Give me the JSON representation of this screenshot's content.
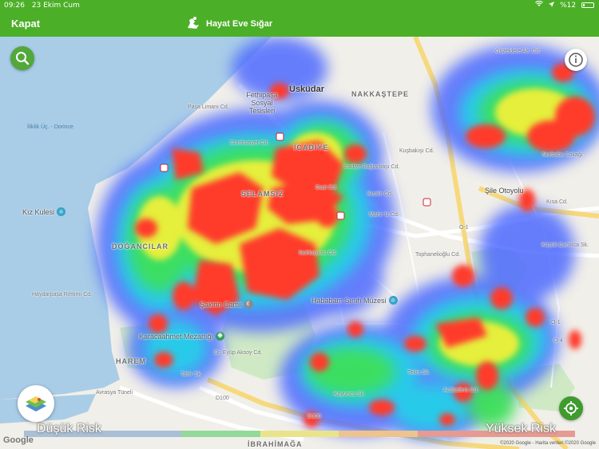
{
  "status_bar": {
    "time": "09:26",
    "date": "23 Ekim Cum",
    "battery": "%12"
  },
  "header": {
    "close_label": "Kapat",
    "title": "Hayat Eve Sığar",
    "logo_icon": "hes-logo-icon"
  },
  "map": {
    "district_labels": {
      "uskudar": "Üsküdar",
      "nakkastepe": "NAKKAŞTEPE",
      "icadiye": "İCADİYE",
      "selamsiz": "SELAMSIZ",
      "doguncular": "DOĞANCILAR",
      "harem": "HAREM",
      "ibrahimaga": "İBRAHİMAĞA"
    },
    "poi_labels": {
      "fethipasa": "Fethipaşa Sosyal Tesisleri",
      "kiz_kulesi": "Kız Kulesi",
      "sakirin": "Şakirin Camii",
      "karacaahmet": "Karacaahmet Mezarlığı",
      "hababam": "Hababam Sınıfı Müzesi"
    },
    "road_labels": {
      "sile": "Şile Otoyolu",
      "mahir": "Mahir İz Cd.",
      "avrasya": "Avrasya Tüneli",
      "kisikli": "Kısıklı Cd.",
      "kisa": "Kısa Cd.",
      "kucukbakkal": "Küçükbakkalköy",
      "kucuk_camlica": "Küçük Çamlıca Sk.",
      "nurbaba": "Nurbaba Sokağı",
      "guzeldere": "Güzeldere Alt. Cd.",
      "gazi": "Gazi Cd.",
      "kuskbaskı": "Kuşbakışı Cd.",
      "topraktaba": "Toprakçeşme Cd.",
      "tophanelioglu": "Tophanelioğlu Cd.",
      "nuhkuyusu": "Nuhkuyusu Cd.",
      "koyuncu": "Koyuncu Sk.",
      "dr_eyup": "Dr. Eyüp Aksoy Cd.",
      "tahir": "Tahir Sk.",
      "paşa_limani": "Paşa Limanı Cd.",
      "cumhuriyet": "Cumhuriyet Cd.",
      "icadiye_cd": "İcadiye Bağlarbaşı Cd.",
      "halk": "Halk Cd.",
      "d100_a": "D100",
      "d100_b": "D100",
      "o1_a": "O-1",
      "o1_b": "O-1",
      "o4": "O-4",
      "ibrahimaga_cd": "Ibrahimağa Cd.",
      "haydarpasa": "Haydarpaşa Rıhtımı Cd.",
      "acibadem": "Acıbadem Cd.",
      "tekin": "Tekin Sk."
    },
    "water_labels": {
      "iliclik": "İliklik Üç. - Dorince"
    }
  },
  "controls": {
    "search_icon": "search-icon",
    "info_icon": "info-icon",
    "layers_icon": "map-layers-icon",
    "locate_icon": "my-location-icon"
  },
  "legend": {
    "low_label": "Düşük Risk",
    "high_label": "Yüksek Risk",
    "colors": [
      "#a8bfd6",
      "#a8bfd6",
      "#93d99a",
      "#e9e48c",
      "#eec38e",
      "#e69a92",
      "#e69a92"
    ]
  },
  "map_footer": {
    "google": "Google",
    "attribution": "©2020 Google - Harita verileri ©2020 Google"
  },
  "colors": {
    "header_green": "#4caf28",
    "water": "#a9cde7",
    "land": "#f1efe9",
    "park": "#cfe9c4",
    "heat_red": "#ff3a2a"
  }
}
